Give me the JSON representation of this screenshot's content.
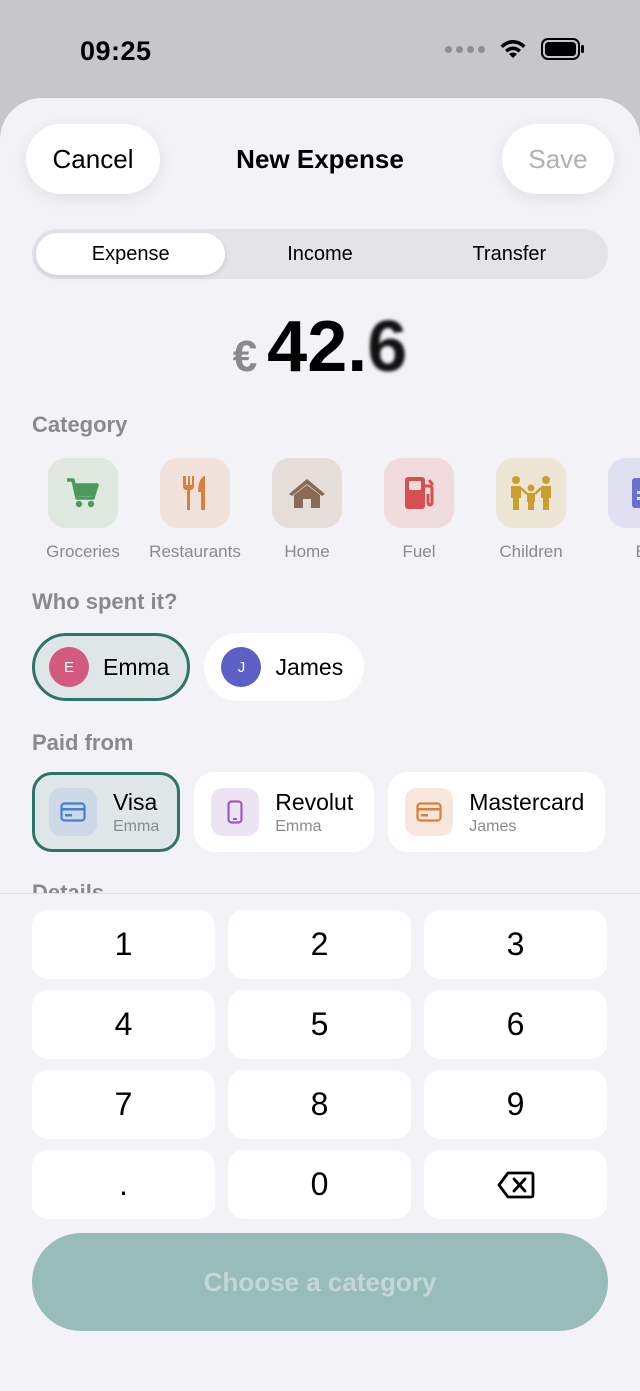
{
  "status": {
    "time": "09:25"
  },
  "nav": {
    "cancel": "Cancel",
    "title": "New Expense",
    "save": "Save"
  },
  "tabs": [
    "Expense",
    "Income",
    "Transfer"
  ],
  "amount": {
    "currency": "€",
    "integer": "42.",
    "decimal": "6"
  },
  "category": {
    "label": "Category",
    "items": [
      {
        "label": "Groceries",
        "icon": "cart-icon",
        "color": "#4a9a5a",
        "bg": "#dfe8df"
      },
      {
        "label": "Restaurants",
        "icon": "fork-knife-icon",
        "color": "#d9803a",
        "bg": "#f0e2da"
      },
      {
        "label": "Home",
        "icon": "home-icon",
        "color": "#8a6a55",
        "bg": "#e5ddd8"
      },
      {
        "label": "Fuel",
        "icon": "fuel-icon",
        "color": "#d65050",
        "bg": "#f1dcdd"
      },
      {
        "label": "Children",
        "icon": "family-icon",
        "color": "#c9a030",
        "bg": "#ede6d5"
      },
      {
        "label": "Bi",
        "icon": "bill-icon",
        "color": "#6a70d0",
        "bg": "#e0e0f3"
      }
    ]
  },
  "who": {
    "label": "Who spent it?",
    "people": [
      {
        "name": "Emma",
        "initial": "E",
        "color": "#d15a7e"
      },
      {
        "name": "James",
        "initial": "J",
        "color": "#5c5fc6"
      }
    ]
  },
  "paid": {
    "label": "Paid from",
    "accounts": [
      {
        "name": "Visa",
        "owner": "Emma",
        "icon": "card-icon",
        "color": "#4a7fd0",
        "bg": "#cdd9e6"
      },
      {
        "name": "Revolut",
        "owner": "Emma",
        "icon": "phone-icon",
        "color": "#9a5ac9",
        "bg": "#ece4f2"
      },
      {
        "name": "Mastercard",
        "owner": "James",
        "icon": "card-icon",
        "color": "#d9803a",
        "bg": "#f7e6db"
      }
    ]
  },
  "details_label": "Details",
  "keypad": [
    "1",
    "2",
    "3",
    "4",
    "5",
    "6",
    "7",
    "8",
    "9",
    ".",
    "0"
  ],
  "cta": "Choose a category"
}
